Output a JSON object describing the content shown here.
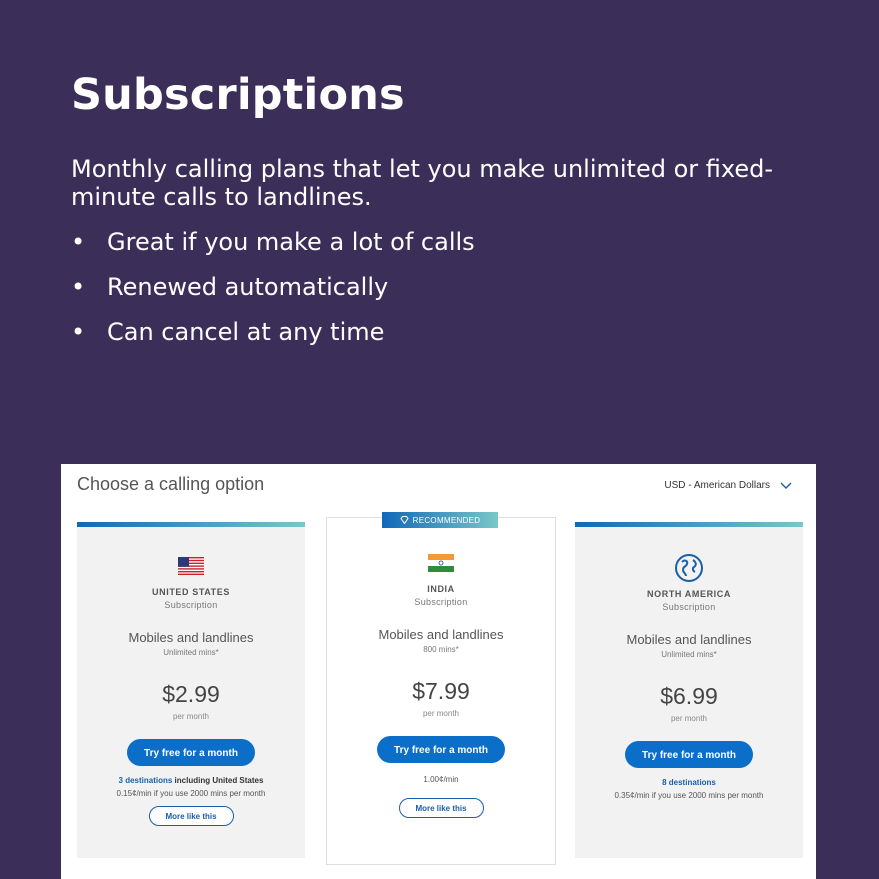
{
  "slide": {
    "title": "Subscriptions",
    "intro": "Monthly calling plans that let you make unlimited or fixed-minute calls to landlines.",
    "bullets": [
      "Great if you make a lot of calls",
      "Renewed automatically",
      "Can cancel at any time"
    ],
    "bullet_char": "•"
  },
  "panel": {
    "title": "Choose a calling option",
    "currency": "USD - American Dollars",
    "recommended_label": "RECOMMENDED",
    "cards": [
      {
        "flag_icon": "us-flag-icon",
        "country": "UNITED STATES",
        "type": "Subscription",
        "plan": "Mobiles and landlines",
        "mins": "Unlimited mins*",
        "price": "$2.99",
        "per": "per month",
        "try_label": "Try free for a month",
        "dest_link": "3 destinations",
        "dest_rest": " including United States",
        "rate": "0.15¢/min if you use 2000 mins per month",
        "more_label": "More like this"
      },
      {
        "flag_icon": "india-flag-icon",
        "country": "INDIA",
        "type": "Subscription",
        "plan": "Mobiles and landlines",
        "mins": "800 mins*",
        "price": "$7.99",
        "per": "per month",
        "try_label": "Try free for a month",
        "rate": "1.00¢/min",
        "more_label": "More like this"
      },
      {
        "flag_icon": "globe-icon",
        "country": "NORTH AMERICA",
        "type": "Subscription",
        "plan": "Mobiles and landlines",
        "mins": "Unlimited mins*",
        "price": "$6.99",
        "per": "per month",
        "try_label": "Try free for a month",
        "dest_link": "8 destinations",
        "rate": "0.35¢/min if you use 2000 mins per month"
      }
    ]
  },
  "colors": {
    "background": "#3b2e58",
    "accent": "#0b6fc9",
    "link": "#1a5fa8"
  }
}
